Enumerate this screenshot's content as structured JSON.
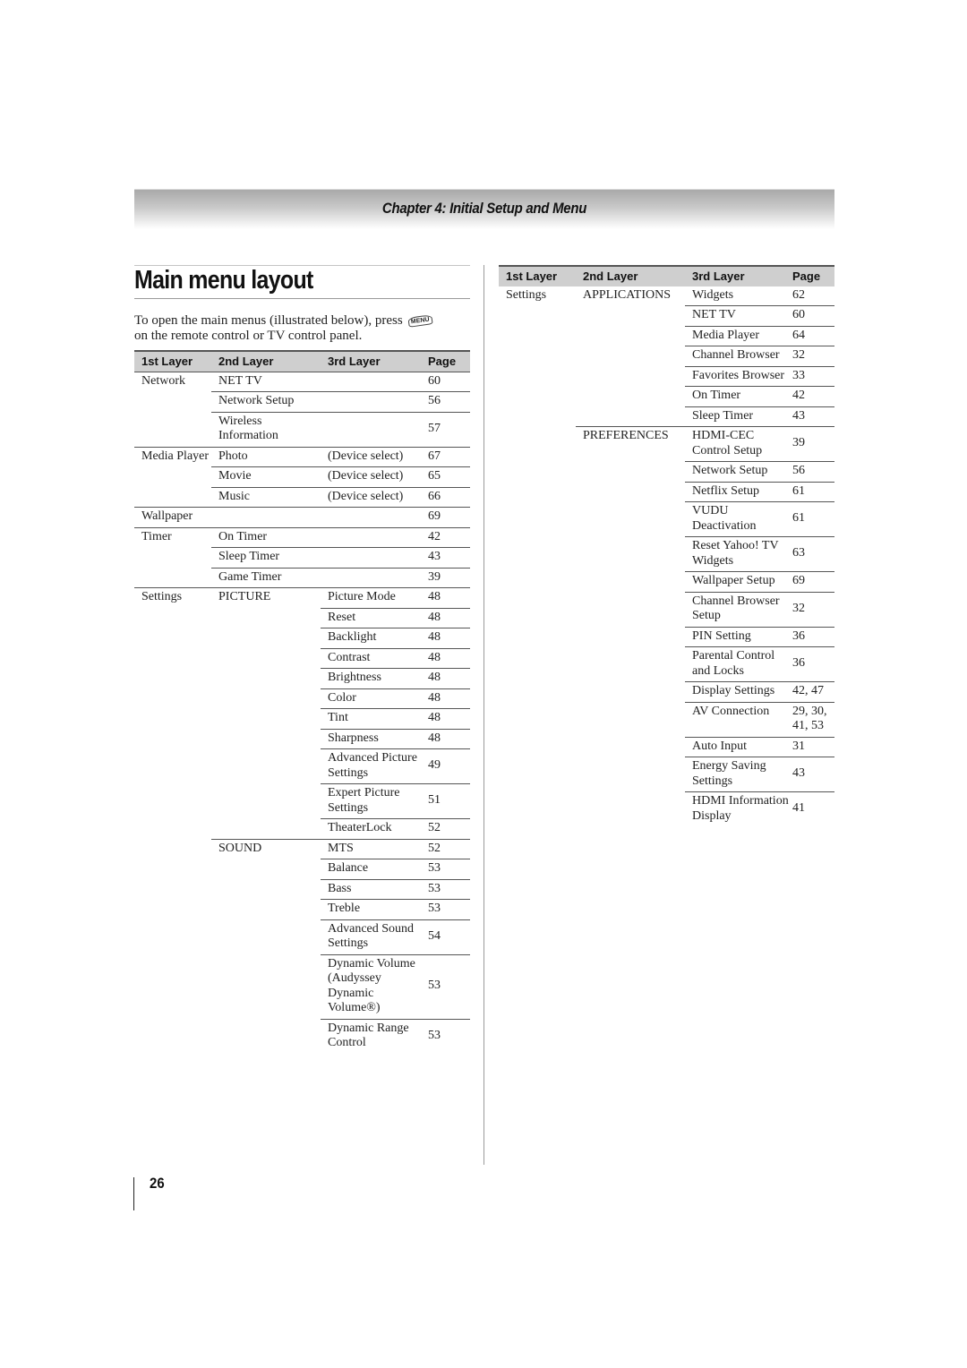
{
  "header": {
    "chapter_title": "Chapter 4: Initial Setup and Menu"
  },
  "section": {
    "title": "Main menu layout",
    "intro_before_icon": "To open the main menus (illustrated below), press",
    "menu_icon_label": "MENU",
    "intro_after_icon": "on the remote control or TV control panel."
  },
  "columns": {
    "first": "1st Layer",
    "second": "2nd Layer",
    "third": "3rd Layer",
    "page": "Page"
  },
  "left_table": {
    "rows": [
      {
        "l1": "Network",
        "l2": "NET TV",
        "l3": "",
        "page": "60",
        "line": "full"
      },
      {
        "l1": "",
        "l2": "Network Setup",
        "l3": "",
        "page": "56",
        "line": "l2"
      },
      {
        "l1": "",
        "l2": "Wireless Information",
        "l3": "",
        "page": "57",
        "line": "l2"
      },
      {
        "l1": "Media Player",
        "l2": "Photo",
        "l3": "(Device select)",
        "page": "67",
        "line": "full"
      },
      {
        "l1": "",
        "l2": "Movie",
        "l3": "(Device select)",
        "page": "65",
        "line": "l2"
      },
      {
        "l1": "",
        "l2": "Music",
        "l3": "(Device select)",
        "page": "66",
        "line": "l2"
      },
      {
        "l1": "Wallpaper",
        "l2": "",
        "l3": "",
        "page": "69",
        "line": "full"
      },
      {
        "l1": "Timer",
        "l2": "On Timer",
        "l3": "",
        "page": "42",
        "line": "full"
      },
      {
        "l1": "",
        "l2": "Sleep Timer",
        "l3": "",
        "page": "43",
        "line": "l2"
      },
      {
        "l1": "",
        "l2": "Game Timer",
        "l3": "",
        "page": "39",
        "line": "l2"
      },
      {
        "l1": "Settings",
        "l2": "PICTURE",
        "l3": "Picture Mode",
        "page": "48",
        "line": "full"
      },
      {
        "l1": "",
        "l2": "",
        "l3": "Reset",
        "page": "48",
        "line": "l3"
      },
      {
        "l1": "",
        "l2": "",
        "l3": "Backlight",
        "page": "48",
        "line": "l3"
      },
      {
        "l1": "",
        "l2": "",
        "l3": "Contrast",
        "page": "48",
        "line": "l3"
      },
      {
        "l1": "",
        "l2": "",
        "l3": "Brightness",
        "page": "48",
        "line": "l3"
      },
      {
        "l1": "",
        "l2": "",
        "l3": "Color",
        "page": "48",
        "line": "l3"
      },
      {
        "l1": "",
        "l2": "",
        "l3": "Tint",
        "page": "48",
        "line": "l3"
      },
      {
        "l1": "",
        "l2": "",
        "l3": "Sharpness",
        "page": "48",
        "line": "l3"
      },
      {
        "l1": "",
        "l2": "",
        "l3": "Advanced Picture Settings",
        "page": "49",
        "line": "l3"
      },
      {
        "l1": "",
        "l2": "",
        "l3": "Expert Picture Settings",
        "page": "51",
        "line": "l3"
      },
      {
        "l1": "",
        "l2": "",
        "l3": "TheaterLock",
        "page": "52",
        "line": "l3"
      },
      {
        "l1": "",
        "l2": "SOUND",
        "l3": "MTS",
        "page": "52",
        "line": "l2"
      },
      {
        "l1": "",
        "l2": "",
        "l3": "Balance",
        "page": "53",
        "line": "l3"
      },
      {
        "l1": "",
        "l2": "",
        "l3": "Bass",
        "page": "53",
        "line": "l3"
      },
      {
        "l1": "",
        "l2": "",
        "l3": "Treble",
        "page": "53",
        "line": "l3"
      },
      {
        "l1": "",
        "l2": "",
        "l3": "Advanced Sound Settings",
        "page": "54",
        "line": "l3"
      },
      {
        "l1": "",
        "l2": "",
        "l3": "Dynamic Volume (Audyssey Dynamic Volume®)",
        "page": "53",
        "line": "l3"
      },
      {
        "l1": "",
        "l2": "",
        "l3": "Dynamic Range Control",
        "page": "53",
        "line": "l3"
      }
    ]
  },
  "right_table": {
    "rows": [
      {
        "l1": "Settings",
        "l2": "APPLICATIONS",
        "l3": "Widgets",
        "page": "62",
        "line": "none"
      },
      {
        "l1": "",
        "l2": "",
        "l3": "NET TV",
        "page": "60",
        "line": "l3"
      },
      {
        "l1": "",
        "l2": "",
        "l3": "Media Player",
        "page": "64",
        "line": "l3"
      },
      {
        "l1": "",
        "l2": "",
        "l3": "Channel Browser",
        "page": "32",
        "line": "l3"
      },
      {
        "l1": "",
        "l2": "",
        "l3": "Favorites Browser",
        "page": "33",
        "line": "l3"
      },
      {
        "l1": "",
        "l2": "",
        "l3": "On Timer",
        "page": "42",
        "line": "l3"
      },
      {
        "l1": "",
        "l2": "",
        "l3": "Sleep Timer",
        "page": "43",
        "line": "l3"
      },
      {
        "l1": "",
        "l2": "PREFERENCES",
        "l3": "HDMI-CEC Control Setup",
        "page": "39",
        "line": "l2"
      },
      {
        "l1": "",
        "l2": "",
        "l3": "Network Setup",
        "page": "56",
        "line": "l3"
      },
      {
        "l1": "",
        "l2": "",
        "l3": "Netflix Setup",
        "page": "61",
        "line": "l3"
      },
      {
        "l1": "",
        "l2": "",
        "l3": "VUDU Deactivation",
        "page": "61",
        "line": "l3"
      },
      {
        "l1": "",
        "l2": "",
        "l3": "Reset Yahoo! TV Widgets",
        "page": "63",
        "line": "l3"
      },
      {
        "l1": "",
        "l2": "",
        "l3": "Wallpaper Setup",
        "page": "69",
        "line": "l3"
      },
      {
        "l1": "",
        "l2": "",
        "l3": "Channel Browser Setup",
        "page": "32",
        "line": "l3"
      },
      {
        "l1": "",
        "l2": "",
        "l3": "PIN Setting",
        "page": "36",
        "line": "l3"
      },
      {
        "l1": "",
        "l2": "",
        "l3": "Parental Control and Locks",
        "page": "36",
        "line": "l3"
      },
      {
        "l1": "",
        "l2": "",
        "l3": "Display Settings",
        "page": "42, 47",
        "line": "l3"
      },
      {
        "l1": "",
        "l2": "",
        "l3": "AV Connection",
        "page": "29, 30, 41, 53",
        "line": "l3"
      },
      {
        "l1": "",
        "l2": "",
        "l3": "Auto Input",
        "page": "31",
        "line": "l3"
      },
      {
        "l1": "",
        "l2": "",
        "l3": "Energy Saving Settings",
        "page": "43",
        "line": "l3"
      },
      {
        "l1": "",
        "l2": "",
        "l3": "HDMI Information Display",
        "page": "41",
        "line": "l3"
      }
    ]
  },
  "footer": {
    "page_number": "26"
  }
}
